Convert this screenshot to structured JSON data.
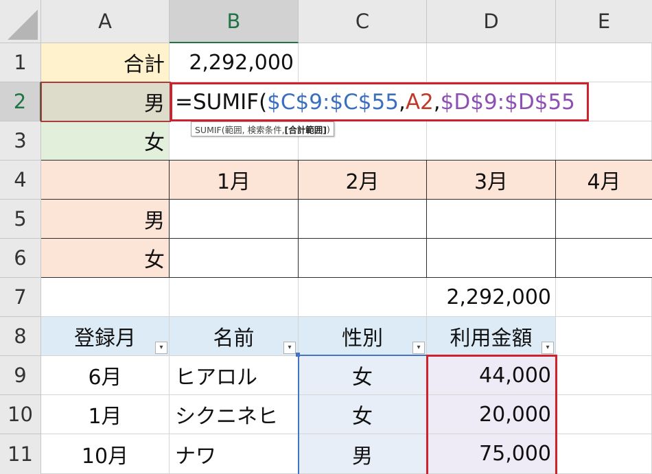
{
  "columns": [
    "A",
    "B",
    "C",
    "D",
    "E"
  ],
  "rows": [
    "1",
    "2",
    "3",
    "4",
    "5",
    "6",
    "7",
    "8",
    "9",
    "10",
    "11"
  ],
  "cells": {
    "A1": "合計",
    "B1": "2,292,000",
    "A2": "男",
    "A3": "女",
    "B4": "1月",
    "C4": "2月",
    "D4": "3月",
    "E4": "4月",
    "A5": "男",
    "A6": "女",
    "D7": "2,292,000",
    "A8": "登録月",
    "B8": "名前",
    "C8": "性別",
    "D8": "利用金額",
    "A9": "6月",
    "B9": "ヒアロル",
    "C9": "女",
    "D9": "44,000",
    "A10": "1月",
    "B10": "シクニネヒ",
    "C10": "女",
    "D10": "20,000",
    "A11": "10月",
    "B11": "ナワ",
    "C11": "男",
    "D11": "75,000"
  },
  "formula": {
    "eq": "=SUMIF(",
    "range": "$C$9:$C$55",
    "comma1": ",",
    "criteria": "A2",
    "comma2": ",",
    "sum_range": "$D$9:$D$55"
  },
  "tooltip": {
    "prefix": "SUMIF(範囲, 検索条件, ",
    "bold": "[合計範囲]",
    "suffix": ")"
  },
  "filter_glyph": "▾",
  "colors": {
    "range_blue": "#3a6fc0",
    "criteria_red": "#c0392b",
    "sum_purple": "#8e4fb5",
    "total_fill": "#fff2cc",
    "male_fill": "#dddbc9",
    "female_fill": "#e2efda",
    "month_fill": "#fce4d6",
    "table_header_fill": "#ddebf7",
    "gender_col_fill": "#e8eef8",
    "amount_col_fill": "#eeeaf6",
    "selected_col_header_text": "#217346"
  }
}
